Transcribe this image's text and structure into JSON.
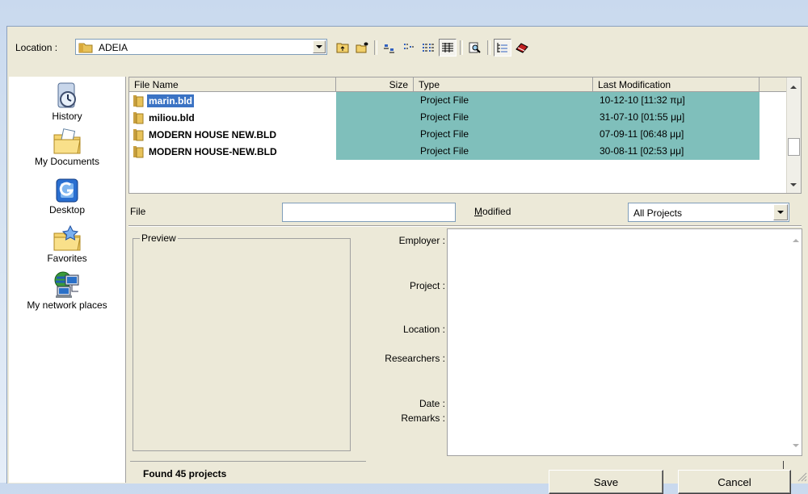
{
  "location": {
    "label": "Location :",
    "value": "ADEIA"
  },
  "toolbar": {
    "icons": [
      "up-folder",
      "new-folder",
      "large-icons",
      "small-icons",
      "list-view",
      "details-view",
      "preview",
      "tree-view",
      "disk"
    ]
  },
  "sidebar": {
    "items": [
      {
        "label": "History",
        "icon": "history"
      },
      {
        "label": "My Documents",
        "icon": "my-documents"
      },
      {
        "label": "Desktop",
        "icon": "desktop"
      },
      {
        "label": "Favorites",
        "icon": "favorites"
      },
      {
        "label": "My network places",
        "icon": "network"
      }
    ]
  },
  "filelist": {
    "columns": {
      "name": "File Name",
      "size": "Size",
      "type": "Type",
      "modified": "Last Modification"
    },
    "rows": [
      {
        "name": "marin.bld",
        "size": "",
        "type": "Project File",
        "modified": "10-12-10 [11:32 πμ]",
        "selected": true
      },
      {
        "name": "miliou.bld",
        "size": "",
        "type": "Project File",
        "modified": "31-07-10 [01:55 μμ]"
      },
      {
        "name": "MODERN HOUSE NEW.BLD",
        "size": "",
        "type": "Project File",
        "modified": "07-09-11 [06:48 μμ]"
      },
      {
        "name": "MODERN HOUSE-NEW.BLD",
        "size": "",
        "type": "Project File",
        "modified": "30-08-11 [02:53 μμ]"
      }
    ]
  },
  "filter": {
    "file_label": "File",
    "file_value": "",
    "modified_label": "Modified",
    "modified_value": "All Projects"
  },
  "preview": {
    "title": "Preview"
  },
  "info": {
    "employer": "Employer :",
    "project": "Project :",
    "location": "Location :",
    "researchers": "Researchers :",
    "date": "Date :",
    "remarks": "Remarks :"
  },
  "status": {
    "text": "Found 45 projects"
  },
  "buttons": {
    "save": "Save",
    "cancel": "Cancel"
  },
  "colors": {
    "row_highlight": "#7fbfbb",
    "selection": "#3b73c4"
  }
}
